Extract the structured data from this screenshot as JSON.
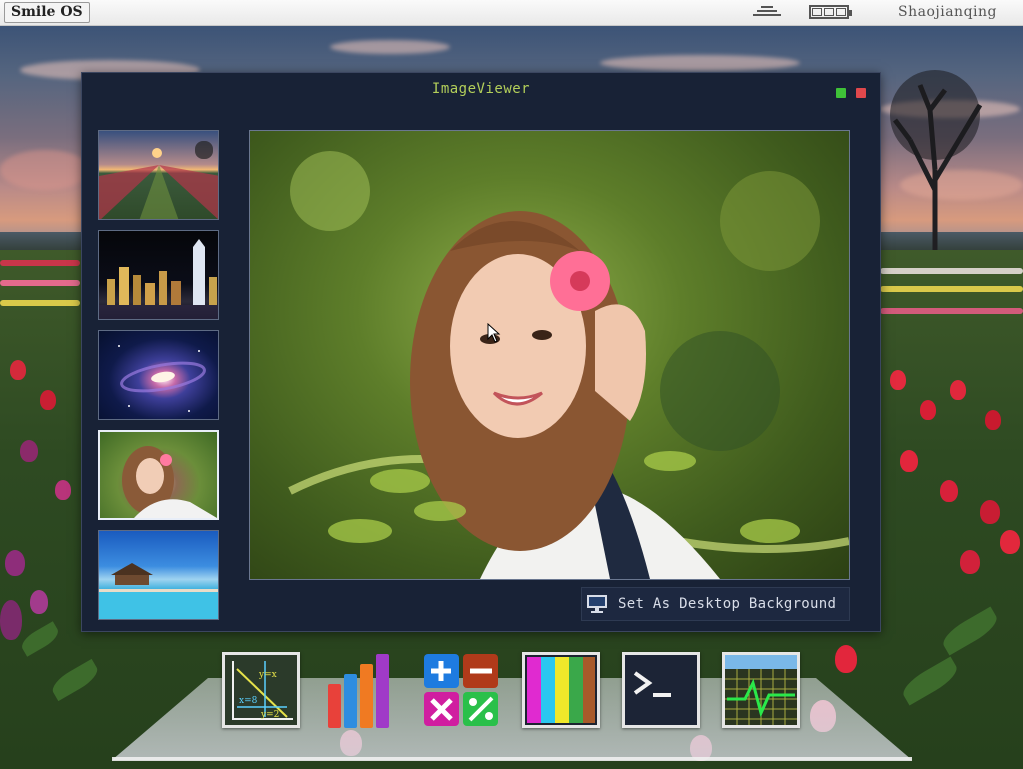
{
  "topbar": {
    "brand": "Smile OS",
    "menu_icon": "stack-menu-icon",
    "battery_icon": "battery-icon",
    "user": "Shaojianqing"
  },
  "window": {
    "title": "ImageViewer",
    "controls": [
      {
        "name": "maximize",
        "color": "#3fc238"
      },
      {
        "name": "close",
        "color": "#e0484c"
      }
    ]
  },
  "viewer": {
    "thumbnails": [
      {
        "subject": "tulip-field-sunset"
      },
      {
        "subject": "city-night-skyline"
      },
      {
        "subject": "spiral-galaxy"
      },
      {
        "subject": "girl-with-hibiscus",
        "selected": true
      },
      {
        "subject": "resort-pool"
      }
    ],
    "main_image": {
      "subject": "girl-with-hibiscus"
    },
    "set_background_label": "Set As Desktop Background"
  },
  "dock": {
    "apps": [
      {
        "name": "math-graph-app",
        "icon": "graph-icon",
        "label_a": "y=x",
        "label_b": "x=8",
        "label_c": "y=2"
      },
      {
        "name": "chart-app",
        "icon": "bar-chart-icon"
      },
      {
        "name": "calculator-app",
        "icon": "calculator-icon"
      },
      {
        "name": "color-app",
        "icon": "color-palette-icon"
      },
      {
        "name": "terminal-app",
        "icon": "terminal-icon"
      },
      {
        "name": "system-monitor-app",
        "icon": "monitor-graph-icon"
      }
    ]
  },
  "colors": {
    "window_bg": "#182236",
    "title": "#b3cf5a",
    "maximize": "#3fc238",
    "close": "#e0484c"
  }
}
